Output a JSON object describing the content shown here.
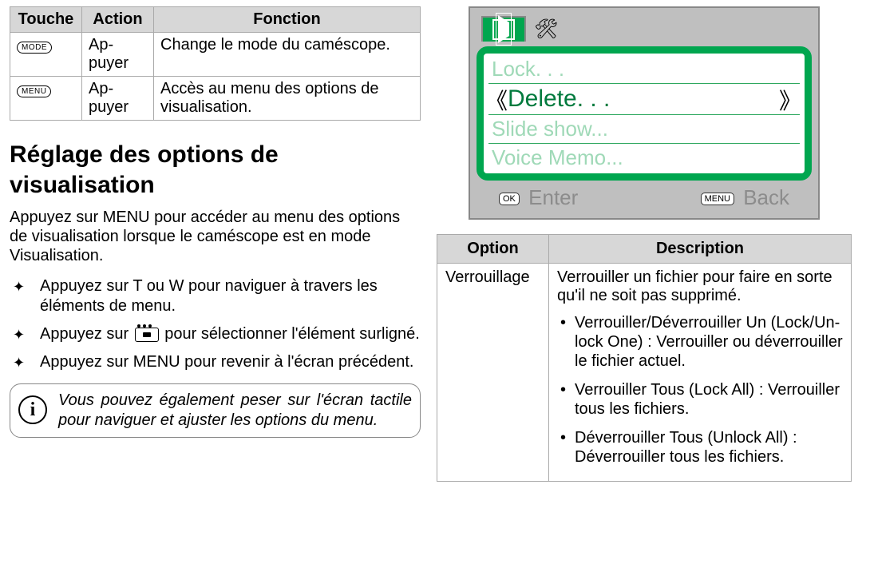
{
  "keyTable": {
    "headers": [
      "Touche",
      "Action",
      "Fonction"
    ],
    "rows": [
      {
        "touche_label": "MODE",
        "action": "Ap-puyer",
        "fonction": "Change le mode du caméscope."
      },
      {
        "touche_label": "MENU",
        "action": "Ap-puyer",
        "fonction": "Accès au menu des options de visualisation."
      }
    ]
  },
  "section_title": "Réglage des options de visualisation",
  "intro_para": "Appuyez sur MENU pour accéder au menu des options de visualisation lorsque le caméscope est en mode Visualisation.",
  "star_items": [
    "Appuyez sur T ou W pour naviguer à travers les éléments de menu.",
    {
      "pre": "Appuyez sur ",
      "post": " pour sélectionner l'élément surligné."
    },
    "Appuyez sur MENU pour revenir à l'écran précédent."
  ],
  "note_text": "Vous pouvez également peser sur l'écran tactile pour naviguer et ajuster les options du menu.",
  "screen": {
    "menu": [
      {
        "label": "Lock. . .",
        "selected": false
      },
      {
        "label": "Delete. . .",
        "selected": true
      },
      {
        "label": "Slide show...",
        "selected": false
      },
      {
        "label": "Voice Memo...",
        "selected": false
      }
    ],
    "footer_left_btn": "OK",
    "footer_left_text": "Enter",
    "footer_right_btn": "MENU",
    "footer_right_text": "Back"
  },
  "optTable": {
    "headers": [
      "Option",
      "Description"
    ],
    "option_name": "Verrouillage",
    "desc_intro": "Verrouiller un fichier pour faire en sorte qu'il ne soit pas supprimé.",
    "bullets": [
      "Verrouiller/Déverrouiller Un (Lock/Un-lock One) : Verrouiller ou déverrouiller le fichier actuel.",
      "Verrouiller Tous (Lock All) : Verrouiller tous les fichiers.",
      "Déverrouiller Tous (Unlock All) : Déverrouiller tous les fichiers."
    ]
  }
}
